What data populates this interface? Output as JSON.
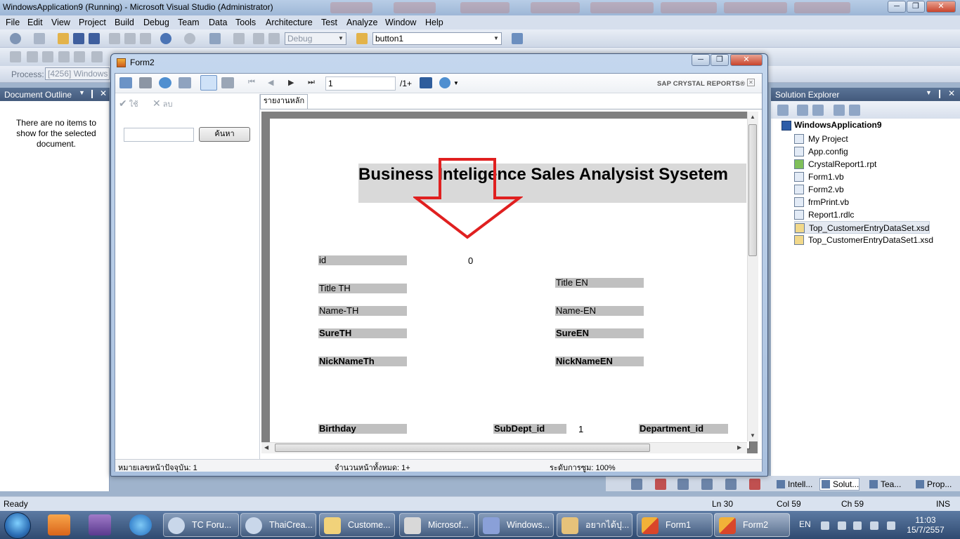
{
  "vs": {
    "title": "WindowsApplication9 (Running) - Microsoft Visual Studio (Administrator)",
    "menu": [
      "File",
      "Edit",
      "View",
      "Project",
      "Build",
      "Debug",
      "Team",
      "Data",
      "Tools",
      "Architecture",
      "Test",
      "Analyze",
      "Window",
      "Help"
    ],
    "toolbar": {
      "config": "Debug",
      "object_combo": "button1",
      "process_label": "Process:",
      "process_value": "[4256] Windows"
    }
  },
  "document_outline": {
    "title": "Document Outline",
    "message": "There are no items to show for the selected document."
  },
  "solution_explorer": {
    "title": "Solution Explorer",
    "root": "WindowsApplication9",
    "items": [
      "My Project",
      "App.config",
      "CrystalReport1.rpt",
      "Form1.vb",
      "Form2.vb",
      "frmPrint.vb",
      "Report1.rdlc",
      "Top_CustomerEntryDataSet.xsd",
      "Top_CustomerEntryDataSet1.xsd"
    ],
    "selected_index": 7
  },
  "bottom_tabs": [
    "Intell...",
    "Solut...",
    "Tea...",
    "Prop..."
  ],
  "status": {
    "ready": "Ready",
    "ln": "Ln 30",
    "col": "Col 59",
    "ch": "Ch 59",
    "mode": "INS"
  },
  "taskbar": {
    "tasks": [
      "TC Foru...",
      "ThaiCrea...",
      "Custome...",
      "Microsof...",
      "Windows...",
      "อยากได้ปุ...",
      "Form1",
      "Form2"
    ],
    "active_index": 7,
    "lang": "EN",
    "time": "11:03",
    "date": "15/7/2557"
  },
  "form2": {
    "title": "Form2",
    "viewer": {
      "page_input": "1",
      "page_total": "/1+",
      "brand": "SAP CRYSTAL REPORTS®",
      "ok_label": "ใช้",
      "delete_label": "ลบ",
      "search_button": "ค้นหา",
      "tab": "รายงานหลัก"
    },
    "report": {
      "title": "Business Inteligence Sales Analysist Sysetem",
      "id_label": "id",
      "id_value": "0",
      "title_th": "Title TH",
      "title_en": "Title EN",
      "name_th": "Name-TH",
      "name_en": "Name-EN",
      "sure_th": "SureTH",
      "sure_en": "SureEN",
      "nick_th": "NickNameTh",
      "nick_en": "NickNameEN",
      "birthday": "Birthday",
      "subdept": "SubDept_id",
      "subdept_value": "1",
      "department": "Department_id"
    },
    "statusbar": {
      "current_page": "หมายเลขหน้าปัจจุบัน: 1",
      "total_pages": "จำนวนหน้าทั้งหมด: 1+",
      "zoom": "ระดับการซูม: 100%"
    }
  }
}
